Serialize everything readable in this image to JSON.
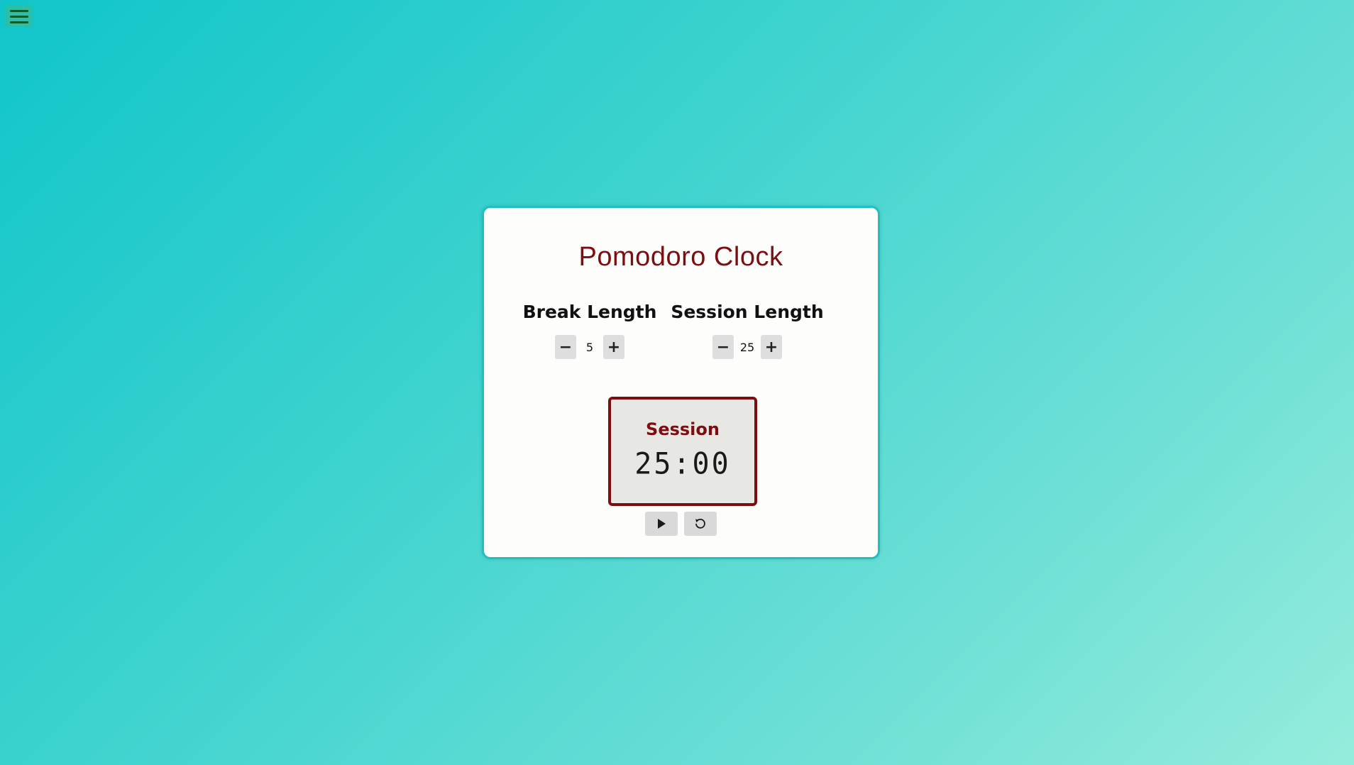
{
  "menu": {
    "icon": "hamburger-menu-icon"
  },
  "app": {
    "title": "Pomodoro Clock"
  },
  "break_length": {
    "label": "Break Length",
    "value": "5",
    "decrement_icon": "minus-icon",
    "increment_icon": "plus-icon",
    "decrement_symbol": "−",
    "increment_symbol": "+"
  },
  "session_length": {
    "label": "Session Length",
    "value": "25",
    "decrement_icon": "minus-icon",
    "increment_icon": "plus-icon",
    "decrement_symbol": "−",
    "increment_symbol": "+"
  },
  "timer": {
    "label": "Session",
    "time": "25:00"
  },
  "actions": {
    "play_icon": "play-icon",
    "reset_icon": "reset-icon"
  },
  "colors": {
    "accent": "#7c0e12",
    "card_border": "#20bfc3",
    "menu_bg": "#2bbfa8",
    "menu_lines": "#0a5d2a"
  }
}
